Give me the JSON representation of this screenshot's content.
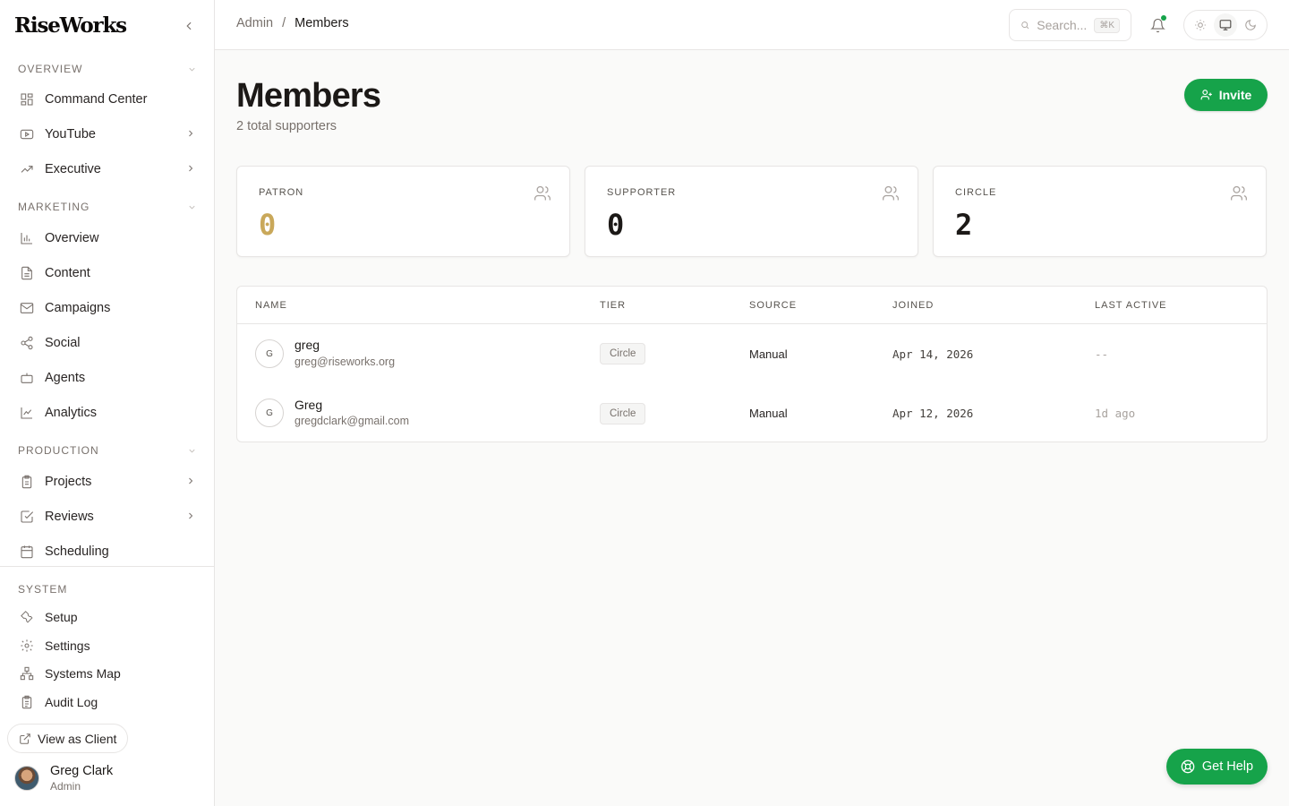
{
  "brand": {
    "name": "RiseWorks"
  },
  "sidebar": {
    "sections": {
      "overview": "OVERVIEW",
      "marketing": "MARKETING",
      "production": "PRODUCTION",
      "system": "SYSTEM"
    },
    "overview_items": [
      {
        "label": "Command Center",
        "icon": "grid-icon"
      },
      {
        "label": "YouTube",
        "icon": "youtube-icon"
      },
      {
        "label": "Executive",
        "icon": "trending-up-icon"
      }
    ],
    "marketing_items": [
      {
        "label": "Overview",
        "icon": "bar-chart-icon"
      },
      {
        "label": "Content",
        "icon": "file-text-icon"
      },
      {
        "label": "Campaigns",
        "icon": "mail-icon"
      },
      {
        "label": "Social",
        "icon": "share-icon"
      },
      {
        "label": "Agents",
        "icon": "bot-icon"
      },
      {
        "label": "Analytics",
        "icon": "line-chart-icon"
      }
    ],
    "production_items": [
      {
        "label": "Projects",
        "icon": "clipboard-icon"
      },
      {
        "label": "Reviews",
        "icon": "check-square-icon"
      },
      {
        "label": "Scheduling",
        "icon": "calendar-icon"
      }
    ],
    "system_items": [
      {
        "label": "Setup",
        "icon": "wrench-icon"
      },
      {
        "label": "Settings",
        "icon": "gear-icon"
      },
      {
        "label": "Systems Map",
        "icon": "network-icon"
      },
      {
        "label": "Audit Log",
        "icon": "clipboard-list-icon"
      }
    ],
    "view_as_client": "View as Client",
    "user": {
      "name": "Greg Clark",
      "role": "Admin"
    }
  },
  "topbar": {
    "breadcrumb": {
      "parent": "Admin",
      "separator": "/",
      "current": "Members"
    },
    "search": {
      "placeholder": "Search...",
      "shortcut": "⌘K"
    },
    "notification_dot_color": "#16a34a"
  },
  "page": {
    "title": "Members",
    "subtitle": "2 total supporters",
    "invite_label": "Invite"
  },
  "stats": [
    {
      "label": "PATRON",
      "value": "0",
      "color": "#c9a85a"
    },
    {
      "label": "SUPPORTER",
      "value": "0",
      "color": "#1c1917"
    },
    {
      "label": "CIRCLE",
      "value": "2",
      "color": "#1c1917"
    }
  ],
  "table": {
    "headers": {
      "name": "NAME",
      "tier": "TIER",
      "source": "SOURCE",
      "joined": "JOINED",
      "last_active": "LAST ACTIVE"
    },
    "rows": [
      {
        "initial": "G",
        "name": "greg",
        "email": "greg@riseworks.org",
        "tier": "Circle",
        "source": "Manual",
        "joined": "Apr 14, 2026",
        "last_active": "--"
      },
      {
        "initial": "G",
        "name": "Greg",
        "email": "gregdclark@gmail.com",
        "tier": "Circle",
        "source": "Manual",
        "joined": "Apr 12, 2026",
        "last_active": "1d ago"
      }
    ]
  },
  "help": {
    "label": "Get Help"
  },
  "colors": {
    "accent": "#16a34a",
    "patron": "#c9a85a"
  }
}
